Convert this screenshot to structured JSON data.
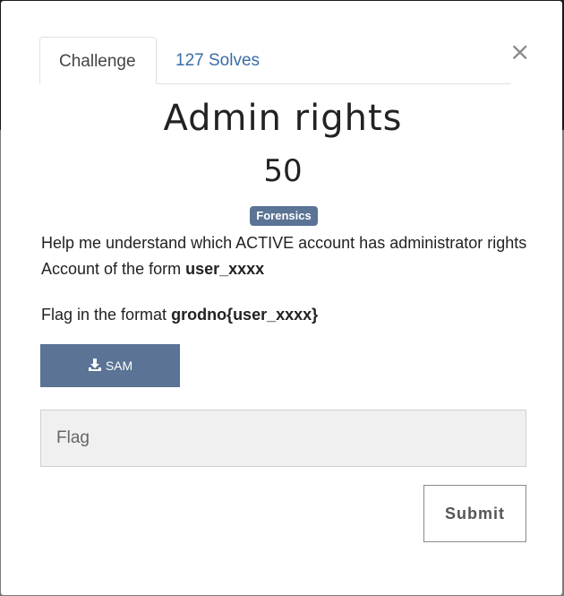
{
  "modal": {
    "close_glyph": "×"
  },
  "tabs": [
    {
      "label": "Challenge",
      "active": true
    },
    {
      "label": "127 Solves",
      "active": false
    }
  ],
  "challenge": {
    "title": "Admin rights",
    "value": "50",
    "category": "Forensics",
    "description_line1": "Help me understand which ACTIVE account has administrator rights Account of the form ",
    "description_bold": "user_xxxx",
    "flag_format_prefix": "Flag in the format ",
    "flag_format_bold": "grodno{user_xxxx}"
  },
  "files": [
    {
      "label": "SAM",
      "icon": "download-icon"
    }
  ],
  "form": {
    "flag_placeholder": "Flag",
    "flag_value": "",
    "submit_label": "Submit"
  },
  "colors": {
    "accent": "#5b7394",
    "link": "#3a6ea5"
  }
}
